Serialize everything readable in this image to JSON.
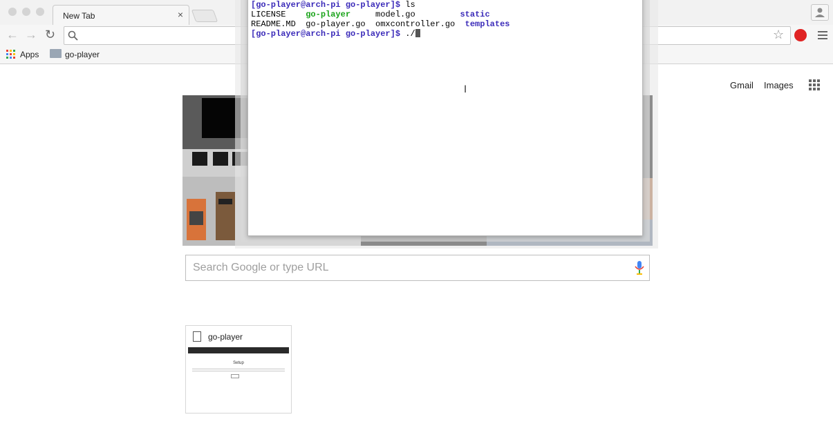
{
  "browser": {
    "tab_title": "New Tab",
    "tab_close": "×",
    "nav": {
      "back": "←",
      "forward": "→",
      "reload": "↻"
    },
    "omnibox_value": "",
    "star_icon": "☆",
    "bookmarks": [
      {
        "label": "Apps",
        "icon": "apps-grid-icon"
      },
      {
        "label": "go-player",
        "icon": "folder-icon"
      }
    ]
  },
  "ntp": {
    "links": {
      "gmail": "Gmail",
      "images": "Images"
    },
    "search_placeholder": "Search Google or type URL",
    "tile": {
      "title": "go-player",
      "thumb_heading": "Setup"
    }
  },
  "terminal": {
    "lines": {
      "l1_prompt": "[go-player@arch-pi go-player]$",
      "l1_cmd": " ls",
      "l2_a": "LICENSE    ",
      "l2_b": "go-player",
      "l2_c": "     model.go         ",
      "l2_d": "static",
      "l3_a": "README.MD  go-player.go  omxcontroller.go  ",
      "l3_d": "templates",
      "l4_prompt": "[go-player@arch-pi go-player]$",
      "l4_cmd": " ./"
    }
  },
  "colors": {
    "prompt": "#3b2bb9",
    "executable": "#1aa31a",
    "directory": "#3b2bb9"
  }
}
